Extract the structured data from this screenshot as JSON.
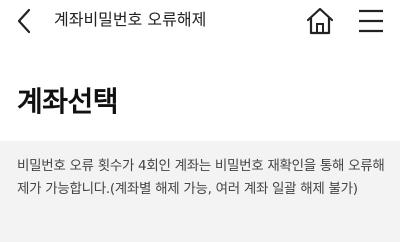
{
  "header": {
    "title": "계좌비밀번호 오류해제"
  },
  "icons": {
    "back": "chevron-left-icon",
    "home": "home-icon",
    "menu": "hamburger-menu-icon"
  },
  "main": {
    "title": "계좌선택"
  },
  "notice": {
    "text": "비밀번호 오류 횟수가 4회인 계좌는 비밀번호 재확인을 통해 오류해제가 가능합니다.(계좌별 해제 가능, 여러 계좌 일괄 해제 불가)"
  },
  "colors": {
    "notice_background": "#f3f3f3",
    "text_primary": "#111111",
    "text_secondary": "#444444"
  }
}
